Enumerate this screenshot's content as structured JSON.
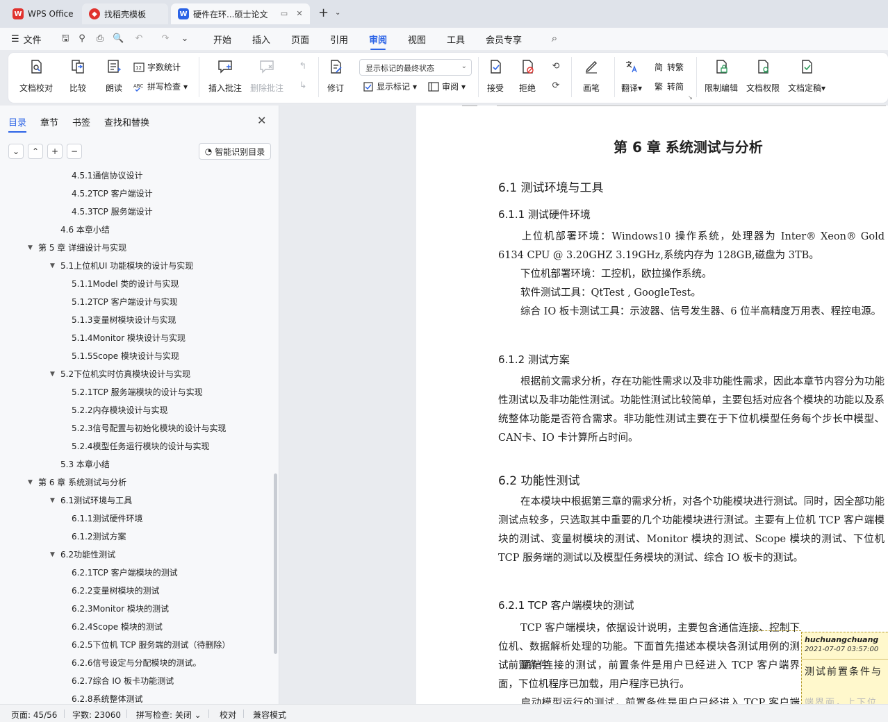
{
  "tabs": {
    "wps": "WPS Office",
    "template": "找稻壳模板",
    "document": "硬件在环...硕士论文"
  },
  "menu": {
    "file": "文件",
    "items": [
      "开始",
      "插入",
      "页面",
      "引用",
      "审阅",
      "视图",
      "工具",
      "会员专享"
    ],
    "active": "审阅"
  },
  "ribbon": {
    "proofread": "文档校对",
    "compare": "比较",
    "read_aloud": "朗读",
    "word_count": "字数统计",
    "spell_check": "拼写检查",
    "insert_comment": "插入批注",
    "delete_comment": "删除批注",
    "revise": "修订",
    "markup_state": "显示标记的最终状态",
    "show_markup": "显示标记",
    "review": "审阅",
    "accept": "接受",
    "reject": "拒绝",
    "pen": "画笔",
    "translate": "翻译",
    "to_traditional": "转繁",
    "to_simplified": "转简",
    "restrict_edit": "限制编辑",
    "doc_rights": "文档权限",
    "doc_finalize": "文档定稿"
  },
  "panel": {
    "tabs": [
      "目录",
      "章节",
      "书签",
      "查找和替换"
    ],
    "smart_toc": "智能识别目录",
    "toc": [
      {
        "text": "4.5.1通信协议设计",
        "level": 3
      },
      {
        "text": "4.5.2TCP 客户端设计",
        "level": 3
      },
      {
        "text": "4.5.3TCP 服务端设计",
        "level": 3
      },
      {
        "text": "4.6 本章小结",
        "level": 2
      },
      {
        "text": "第 5 章 详细设计与实现",
        "level": 1,
        "expanded": true
      },
      {
        "text": "5.1上位机UI 功能模块的设计与实现",
        "level": 2,
        "expanded": true
      },
      {
        "text": "5.1.1Model 类的设计与实现",
        "level": 3
      },
      {
        "text": "5.1.2TCP 客户端设计与实现",
        "level": 3
      },
      {
        "text": "5.1.3变量树模块设计与实现",
        "level": 3
      },
      {
        "text": "5.1.4Monitor 模块设计与实现",
        "level": 3
      },
      {
        "text": "5.1.5Scope 模块设计与实现",
        "level": 3
      },
      {
        "text": "5.2下位机实时仿真模块设计与实现",
        "level": 2,
        "expanded": true
      },
      {
        "text": "5.2.1TCP 服务端模块的设计与实现",
        "level": 3
      },
      {
        "text": "5.2.2内存模块设计与实现",
        "level": 3
      },
      {
        "text": "5.2.3信号配置与初始化模块的设计与实现",
        "level": 3
      },
      {
        "text": "5.2.4模型任务运行模块的设计与实现",
        "level": 3
      },
      {
        "text": "5.3 本章小结",
        "level": 2
      },
      {
        "text": "第 6 章 系统测试与分析",
        "level": 1,
        "expanded": true
      },
      {
        "text": "6.1测试环境与工具",
        "level": 2,
        "expanded": true
      },
      {
        "text": "6.1.1测试硬件环境",
        "level": 3
      },
      {
        "text": "6.1.2测试方案",
        "level": 3
      },
      {
        "text": "6.2功能性测试",
        "level": 2,
        "expanded": true
      },
      {
        "text": "6.2.1TCP 客户端模块的测试",
        "level": 3
      },
      {
        "text": "6.2.2变量树模块的测试",
        "level": 3
      },
      {
        "text": "6.2.3Monitor 模块的测试",
        "level": 3
      },
      {
        "text": "6.2.4Scope 模块的测试",
        "level": 3
      },
      {
        "text": "6.2.5下位机 TCP 服务端的测试（待删除）",
        "level": 3
      },
      {
        "text": "6.2.6信号设定与分配模块的测试。",
        "level": 3
      },
      {
        "text": "6.2.7综合 IO 板卡功能测试",
        "level": 3
      },
      {
        "text": "6.2.8系统整体测试",
        "level": 3
      }
    ]
  },
  "document": {
    "chapter_title": "第  6 章  系统测试与分析",
    "s61": "6.1  测试环境与工具",
    "s611": "6.1.1 测试硬件环境",
    "p1": "上位机部署环境：Windows10 操作系统，处理器为  Inter® Xeon® Gold 6134 CPU @ 3.20GHZ 3.19GHz,系统内存为  128GB,磁盘为  3TB。",
    "p2": "下位机部署环境：工控机，欧拉操作系统。",
    "p3": "软件测试工具：QtTest , GoogleTest。",
    "p4": "综合  IO 板卡测试工具：示波器、信号发生器、6 位半高精度万用表、程控电源。",
    "s612": "6.1.2 测试方案",
    "p5": "根据前文需求分析，存在功能性需求以及非功能性需求，因此本章节内容分为功能性测试以及非功能性测试。功能性测试比较简单，主要包括对应各个模块的功能以及系统整体功能是否符合需求。非功能性测试主要在于下位机模型任务每个步长中模型、CAN卡、IO 卡计算所占时间。",
    "s62": "6.2 功能性测试",
    "p6": "在本模块中根据第三章的需求分析，对各个功能模块进行测试。同时，因全部功能测试点较多，只选取其中重要的几个功能模块进行测试。主要有上位机 TCP 客户端模块的测试、变量树模块的测试、Monitor 模块的测试、Scope 模块的测试、下位机  TCP 服务端的测试以及模型任务模块的测试、综合  IO 板卡的测试。",
    "s621": "6.2.1 TCP 客户端模块的测试",
    "p7": "TCP 客户端模块，依据设计说明，主要包含通信连接、控制下位机、数据解析处理的功能。下面首先描述本模块各测试用例的测试前置条件",
    "p8": "通信连接的测试，前置条件是用户已经进入  TCP 客户端界面，下位机程序已加载，用户程序已执行。",
    "p9": "启动模型运行的测试，前置条件是用户已经进入  TCP 客户端界面，上下位"
  },
  "comment": {
    "author": "huchuangchuang",
    "time": "2021-07-07 03:57:00",
    "text": "测试前置条件与",
    "text2": "端界面，上下位"
  },
  "status": {
    "page": "页面: 45/56",
    "words": "字数: 23060",
    "spell": "拼写检查: 关闭",
    "proof": "校对",
    "compat": "兼容模式"
  },
  "colors": {
    "accent": "#2b63e6",
    "wps_red": "#e0322e",
    "comment_bg": "#fff8cc"
  }
}
